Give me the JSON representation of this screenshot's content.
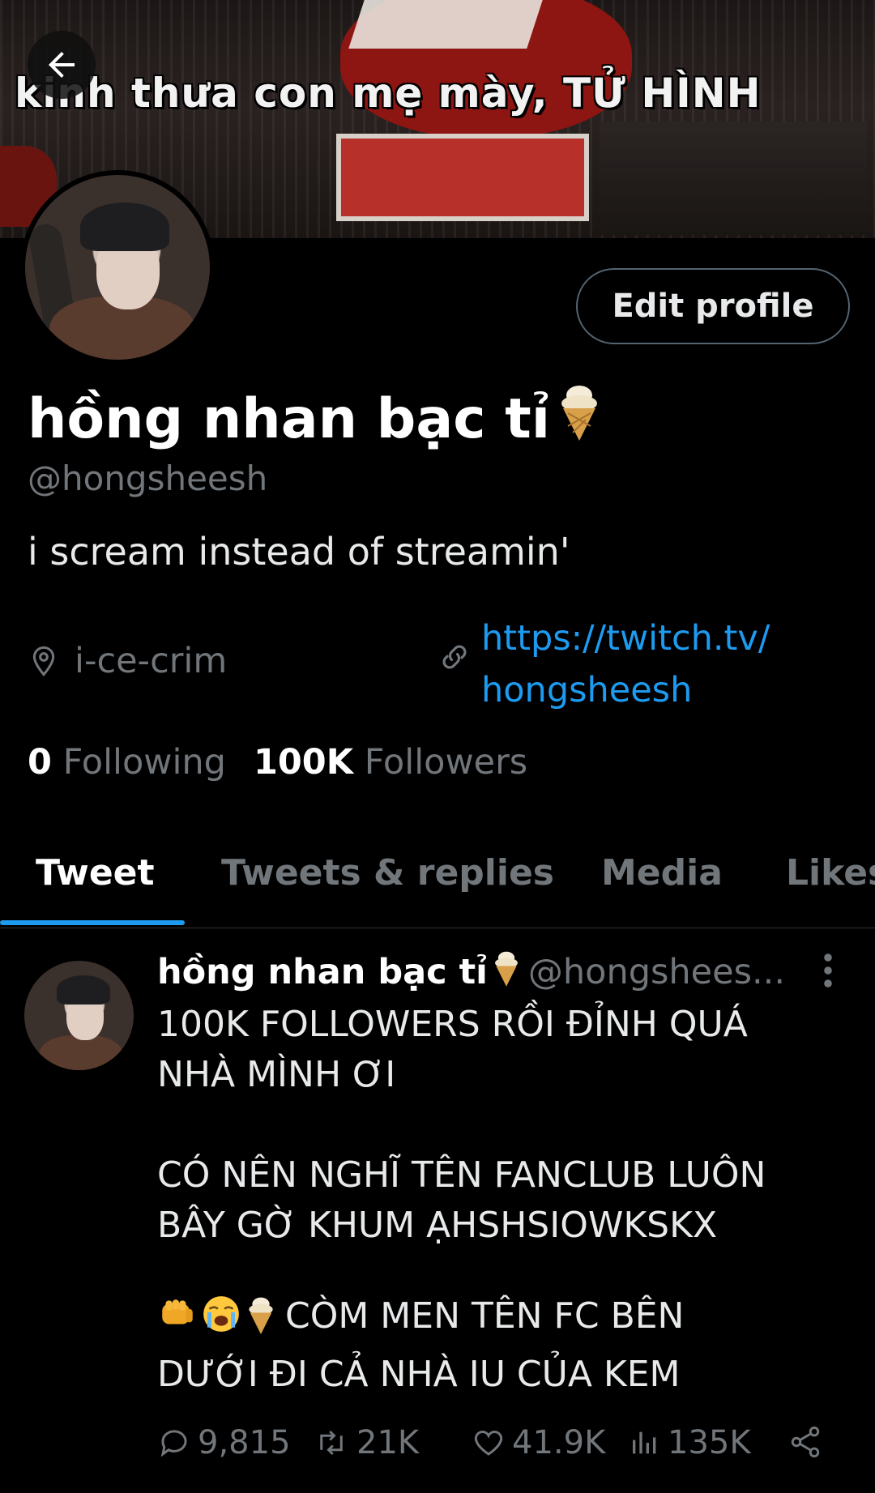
{
  "banner": {
    "caption": "kinh thưa con mẹ mày, TỬ HÌNH"
  },
  "header": {
    "back_label": "Back"
  },
  "profile": {
    "edit_label": "Edit profile",
    "display_name": "hồng nhan bạc tỉ",
    "handle": "@hongsheesh",
    "bio": "i scream instead of streamin'",
    "location": "i-ce-crim",
    "link_line1": "https://twitch.tv/",
    "link_line2": "hongsheesh",
    "following_count": "0",
    "following_label": "Following",
    "followers_count": "100K",
    "followers_label": "Followers"
  },
  "tabs": [
    {
      "label": "Tweet",
      "active": true
    },
    {
      "label": "Tweets & replies",
      "active": false
    },
    {
      "label": "Media",
      "active": false
    },
    {
      "label": "Likes",
      "active": false
    }
  ],
  "tweet": {
    "name": "hồng nhan bạc tỉ",
    "handle": "@hongshees...",
    "text_block1": "100K FOLLOWERS RỒI ĐỈNH QUÁ\nNHÀ MÌNH ƠI\n\nCÓ NÊN NGHĨ TÊN FANCLUB LUÔN\nBÂY GỜ KHUM ẠHSHSIOWKSKX",
    "text_line3a": "CÒM MEN TÊN FC BÊN",
    "text_line3b": "DƯỚI ĐI CẢ NHÀ IU CỦA KEM",
    "emojis": [
      "fist-icon",
      "crying-face-icon",
      "ice-cream-icon"
    ],
    "replies": "9,815",
    "retweets": "21K",
    "likes": "41.9K",
    "views": "135K"
  },
  "colors": {
    "background": "#000000",
    "accent": "#1d9bf0",
    "text": "#e7e9ea",
    "muted": "#71767b",
    "border": "#536471"
  }
}
